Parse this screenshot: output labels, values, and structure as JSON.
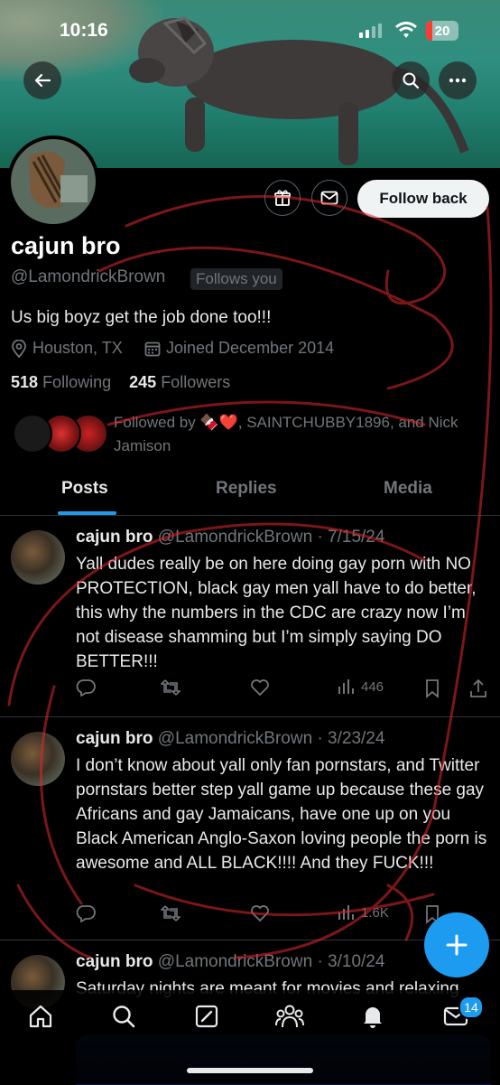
{
  "status_bar": {
    "time": "10:16",
    "battery": "20",
    "battery_level": 0.2
  },
  "profile": {
    "name": "cajun bro",
    "handle": "@LamondrickBrown",
    "follows_you": "Follows you",
    "bio": "Us big boyz get the job done too!!!",
    "location": "Houston, TX",
    "joined": "Joined December 2014",
    "following_count": "518",
    "following_label": "Following",
    "followers_count": "245",
    "followers_label": "Followers",
    "followed_by": "Followed by 🍫❤️, SAINTCHUBBY1896, and Nick Jamison",
    "follow_back_label": "Follow back"
  },
  "tabs": [
    "Posts",
    "Replies",
    "Media"
  ],
  "posts": [
    {
      "name": "cajun bro",
      "handle": "@LamondrickBrown",
      "date": "· 7/15/24",
      "text": "Yall dudes really be on here doing gay porn with NO PROTECTION, black gay men yall have to do better, this why the numbers in the CDC are crazy now I’m not disease shamming but I’m simply saying DO BETTER!!!",
      "views": "446"
    },
    {
      "name": "cajun bro",
      "handle": "@LamondrickBrown",
      "date": "· 3/23/24",
      "text": "I don’t know about yall only fan pornstars, and Twitter pornstars better step yall game up because these gay Africans and gay Jamaicans, have one up on you Black American Anglo-Saxon loving people the porn is awesome and ALL BLACK!!!! And they FUCK!!!",
      "views": "1.6K"
    },
    {
      "name": "cajun bro",
      "handle": "@LamondrickBrown",
      "date": "· 3/10/24",
      "text": "Saturday nights are meant for movies and relaxing",
      "views": ""
    }
  ],
  "nav": {
    "messages_badge": "14"
  },
  "colors": {
    "accent": "#1d9bf0",
    "annotation_red": "#e0282e"
  },
  "icons": [
    "back-arrow-icon",
    "search-icon",
    "more-icon",
    "gift-icon",
    "mail-icon",
    "location-icon",
    "calendar-icon",
    "reply-icon",
    "retweet-icon",
    "like-icon",
    "views-icon",
    "bookmark-icon",
    "share-icon",
    "plus-icon",
    "home-icon",
    "explore-icon",
    "grok-icon",
    "communities-icon",
    "notifications-icon",
    "messages-icon"
  ]
}
